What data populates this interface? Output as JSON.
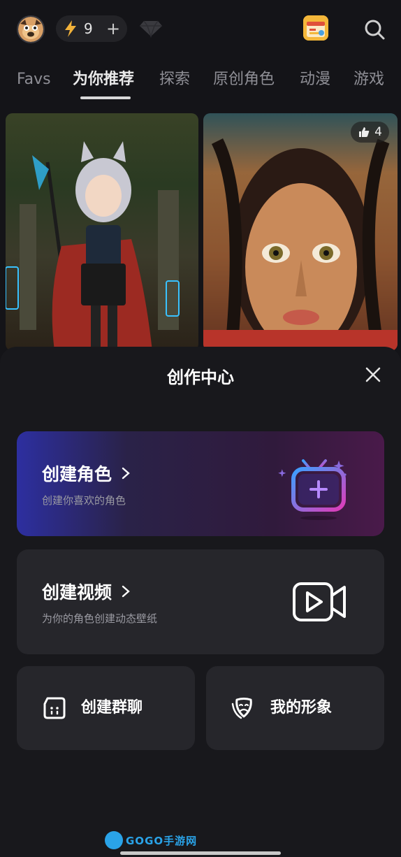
{
  "header": {
    "avatar_icon": "pug-avatar-icon",
    "energy_count": "9",
    "energy_plus": "+",
    "diamond_icon": "diamond-icon",
    "calendar_icon": "calendar-icon",
    "search_icon": "search-icon"
  },
  "tabs": [
    {
      "label": "Favs",
      "active": false
    },
    {
      "label": "为你推荐",
      "active": true
    },
    {
      "label": "探索",
      "active": false
    },
    {
      "label": "原创角色",
      "active": false
    },
    {
      "label": "动漫",
      "active": false
    },
    {
      "label": "游戏",
      "active": false
    }
  ],
  "feed": {
    "cards": [
      {
        "image": "anime-fox-girl-image",
        "likes": ""
      },
      {
        "image": "portrait-woman-image",
        "likes": "4"
      }
    ]
  },
  "sheet": {
    "title": "创作中心",
    "close_icon": "close-icon",
    "create_character": {
      "title": "创建角色",
      "subtitle": "创建你喜欢的角色",
      "icon": "tv-sparkle-icon"
    },
    "create_video": {
      "title": "创建视频",
      "subtitle": "为你的角色创建动态壁纸",
      "icon": "video-camera-icon"
    },
    "create_group_chat": {
      "label": "创建群聊",
      "icon": "group-chat-icon"
    },
    "my_persona": {
      "label": "我的形象",
      "icon": "theater-mask-icon"
    }
  },
  "watermark": {
    "text": "GOGO手游网"
  },
  "colors": {
    "background": "#141418",
    "sheet": "#18181c",
    "card": "#26262b",
    "accent_blue": "#2d2fa0",
    "accent_magenta": "#4a1a4a",
    "energy_bolt": "#f2b23a"
  }
}
